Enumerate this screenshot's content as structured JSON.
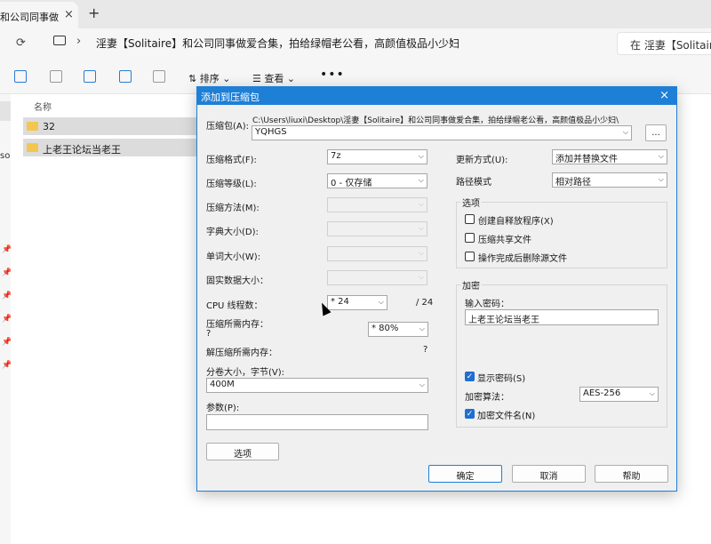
{
  "tab": {
    "title": "和公司同事做",
    "close": "×",
    "new": "+"
  },
  "address": {
    "breadcrumb": "淫妻【Solitaire】和公司同事做爱合集，拍给绿帽老公看，高颜值极品小少妇",
    "search": "在 淫妻【Solitaire】"
  },
  "toolbar": {
    "sort": "⇅ 排序 ⌄",
    "view": "☰ 查看 ⌄",
    "more": "•••"
  },
  "nav": {
    "fragment": "sor"
  },
  "list": {
    "column_name": "名称",
    "items": [
      "32",
      "上老王论坛当老王"
    ]
  },
  "dialog": {
    "title": "添加到压缩包",
    "archive_label": "压缩包(A):",
    "archive_path": "C:\\Users\\liuxi\\Desktop\\淫妻【Solitaire】和公司同事做爱合集，拍给绿帽老公看，高颜值极品小少妇\\",
    "archive_name": "YQHGS",
    "browse": "...",
    "format_label": "压缩格式(F):",
    "format_value": "7z",
    "level_label": "压缩等级(L):",
    "level_value": "0 - 仅存储",
    "method_label": "压缩方法(M):",
    "dict_label": "字典大小(D):",
    "word_label": "单词大小(W):",
    "solid_label": "固实数据大小：",
    "threads_label": "CPU 线程数：",
    "threads_value": "* 24",
    "threads_max": "/ 24",
    "mem_label": "压缩所需内存：",
    "mem_q": "?",
    "mem_value": "* 80%",
    "decomp_label": "解压缩所需内存：",
    "decomp_q": "?",
    "split_label": "分卷大小，字节(V):",
    "split_value": "400M",
    "params_label": "参数(P):",
    "params_value": "",
    "options_button": "选项",
    "update_label": "更新方式(U):",
    "update_value": "添加并替换文件",
    "path_label": "路径模式",
    "path_value": "相对路径",
    "options_group": "选项",
    "opt_sfx": "创建自释放程序(X)",
    "opt_shared": "压缩共享文件",
    "opt_delete": "操作完成后删除源文件",
    "encrypt_group": "加密",
    "pw_label": "输入密码：",
    "pw_value": "上老王论坛当老王",
    "show_pw": "显示密码(S)",
    "enc_method_label": "加密算法：",
    "enc_method_value": "AES-256",
    "enc_names": "加密文件名(N)",
    "ok": "确定",
    "cancel": "取消",
    "help": "帮助",
    "close": "×"
  }
}
